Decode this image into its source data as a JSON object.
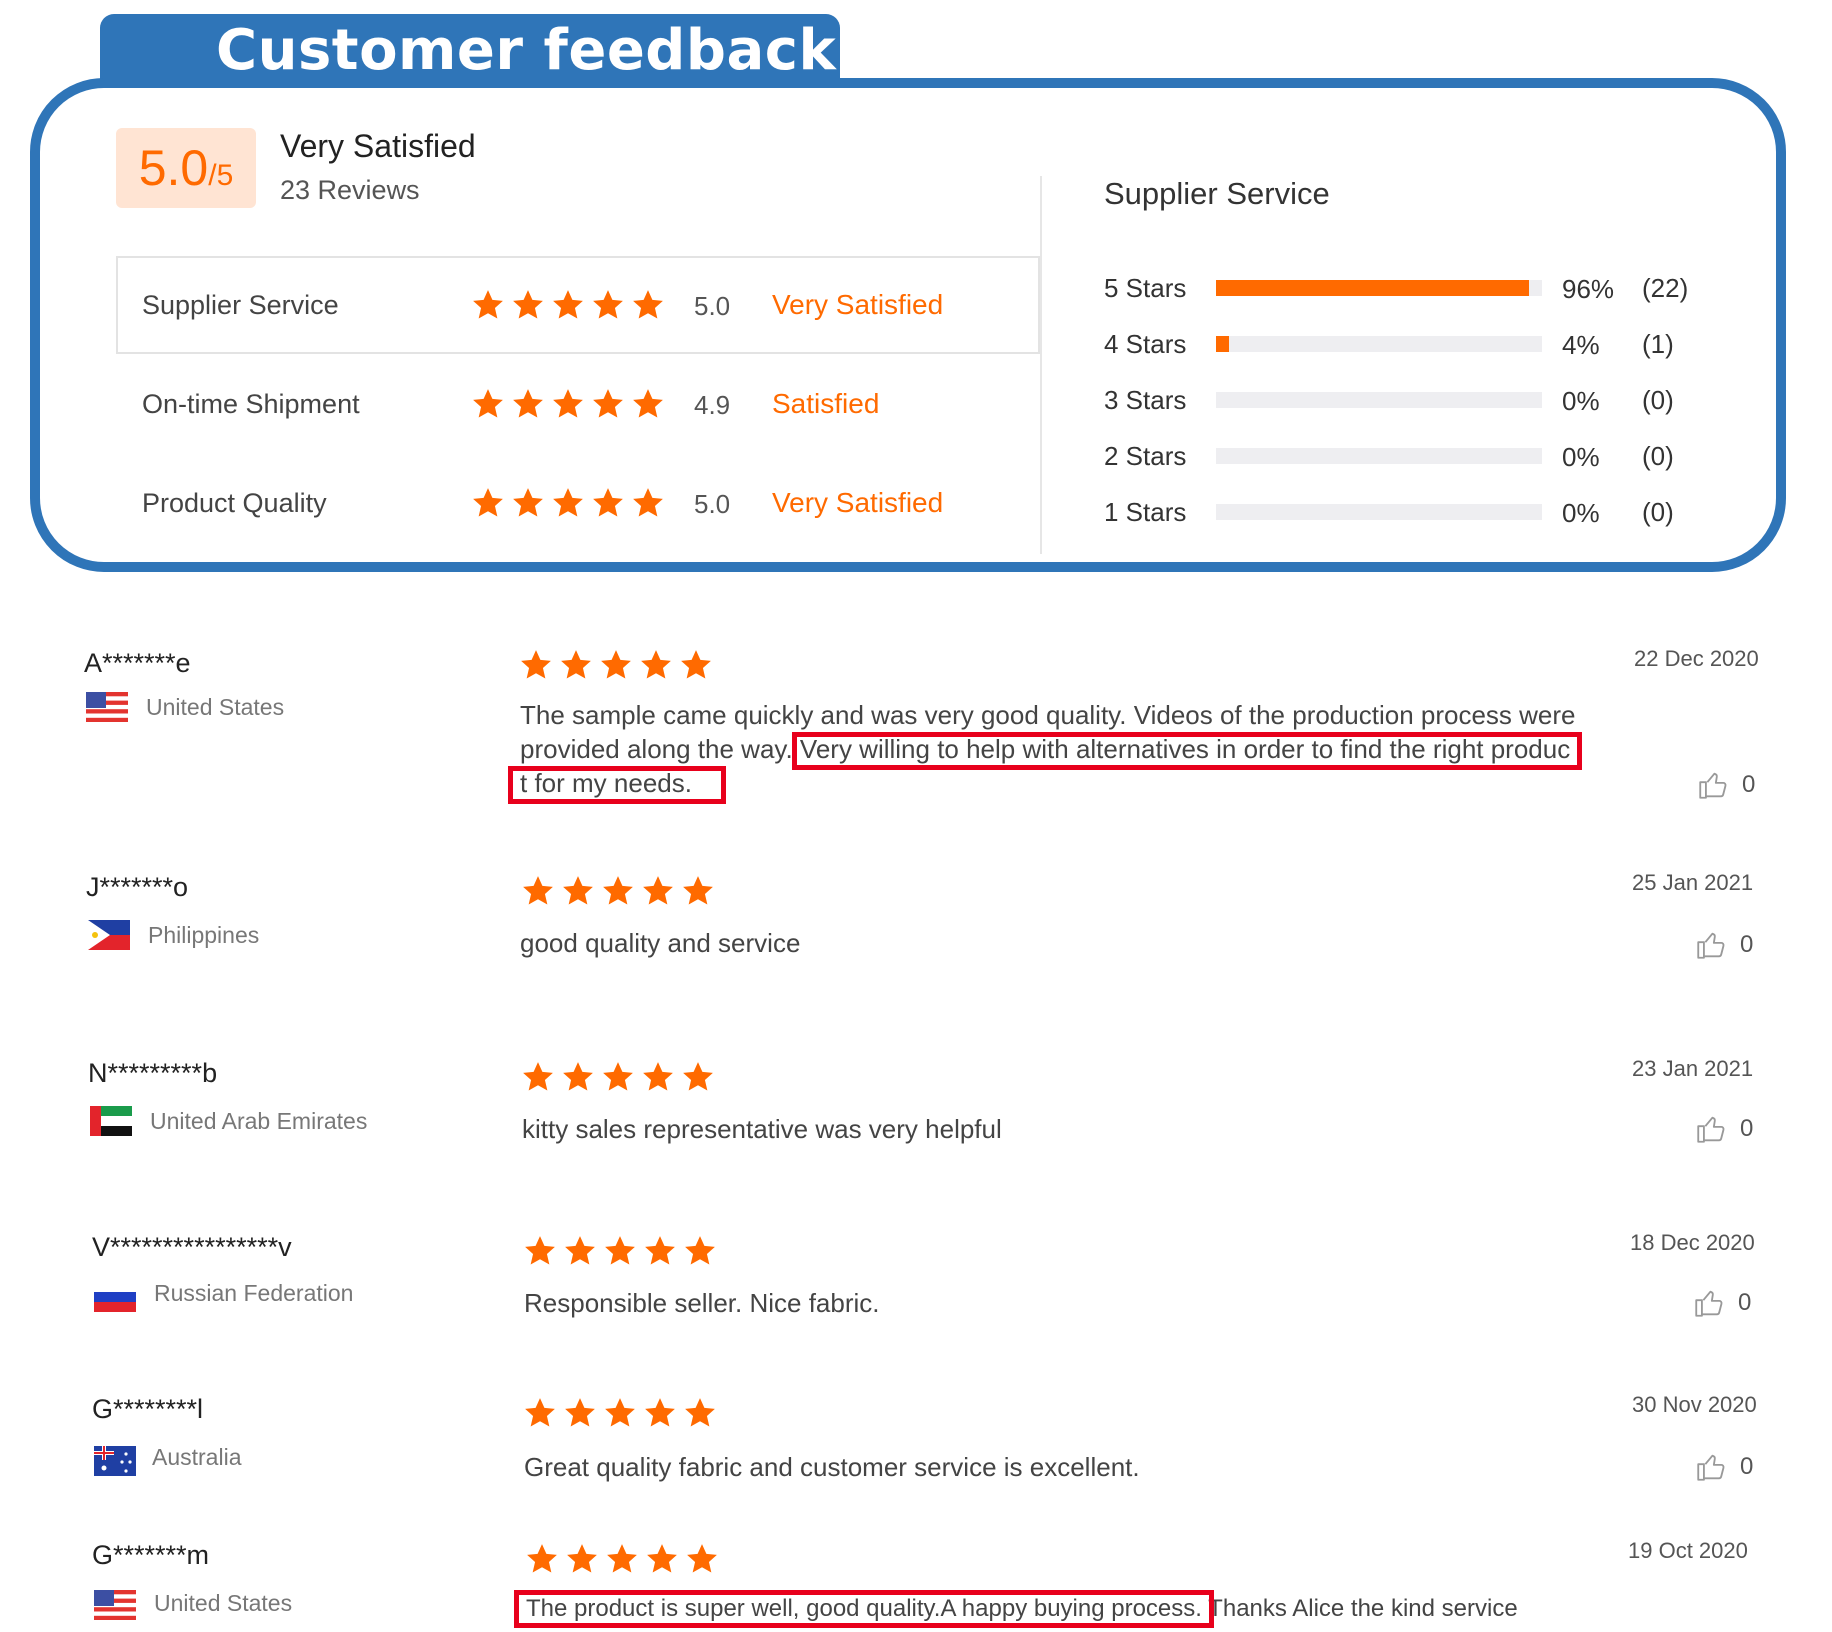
{
  "header": {
    "title": "Customer feedback"
  },
  "summary": {
    "score": "5.0",
    "score_denominator": "/5",
    "overall_label": "Very Satisfied",
    "reviews_count": "23 Reviews",
    "categories": [
      {
        "label": "Supplier Service",
        "rating": 5.0,
        "value": "5.0",
        "desc": "Very Satisfied"
      },
      {
        "label": "On-time Shipment",
        "rating": 4.9,
        "value": "4.9",
        "desc": "Satisfied"
      },
      {
        "label": "Product Quality",
        "rating": 5.0,
        "value": "5.0",
        "desc": "Very Satisfied"
      }
    ],
    "distribution_title": "Supplier Service",
    "distribution": [
      {
        "label": "5  Stars",
        "fraction": 0.96,
        "pct": "96%",
        "count": "(22)"
      },
      {
        "label": "4  Stars",
        "fraction": 0.04,
        "pct": "4%",
        "count": "(1)"
      },
      {
        "label": "3  Stars",
        "fraction": 0,
        "pct": "0%",
        "count": "(0)"
      },
      {
        "label": "2  Stars",
        "fraction": 0,
        "pct": "0%",
        "count": "(0)"
      },
      {
        "label": "1  Stars",
        "fraction": 0,
        "pct": "0%",
        "count": "(0)"
      }
    ]
  },
  "reviews": [
    {
      "name": "A*******e",
      "country": "United States",
      "flag": "us-flag",
      "stars": 5,
      "text_line1": "The sample came quickly and was very good quality. Videos of the production process were",
      "text_line2": "provided along the way. Very willing to help with alternatives in order to find the right produc",
      "text_line3": "t for my needs.",
      "date": "22 Dec 2020",
      "likes": "0"
    },
    {
      "name": "J*******o",
      "country": "Philippines",
      "flag": "ph-flag",
      "stars": 5,
      "text_line1": "good quality and service",
      "date": "25 Jan 2021",
      "likes": "0"
    },
    {
      "name": "N*********b",
      "country": "United Arab Emirates",
      "flag": "ae-flag",
      "stars": 5,
      "text_line1": "kitty sales representative was very helpful",
      "date": "23 Jan 2021",
      "likes": "0"
    },
    {
      "name": "V****************v",
      "country": "Russian Federation",
      "flag": "ru-flag",
      "stars": 5,
      "text_line1": "Responsible seller. Nice fabric.",
      "date": "18 Dec 2020",
      "likes": "0"
    },
    {
      "name": "G********l",
      "country": "Australia",
      "flag": "au-flag",
      "stars": 5,
      "text_line1": "Great quality fabric and customer service is excellent.",
      "date": "30 Nov 2020",
      "likes": "0"
    },
    {
      "name": "G*******m",
      "country": "United States",
      "flag": "us-flag",
      "stars": 5,
      "text_line1": "The product is super well, good quality.A happy buying process. Thanks Alice the kind service",
      "date": "19 Oct 2020",
      "likes": "0"
    }
  ],
  "colors": {
    "accent": "#ff6a00",
    "frame": "#2f75b8",
    "highlight": "#e8001c"
  }
}
